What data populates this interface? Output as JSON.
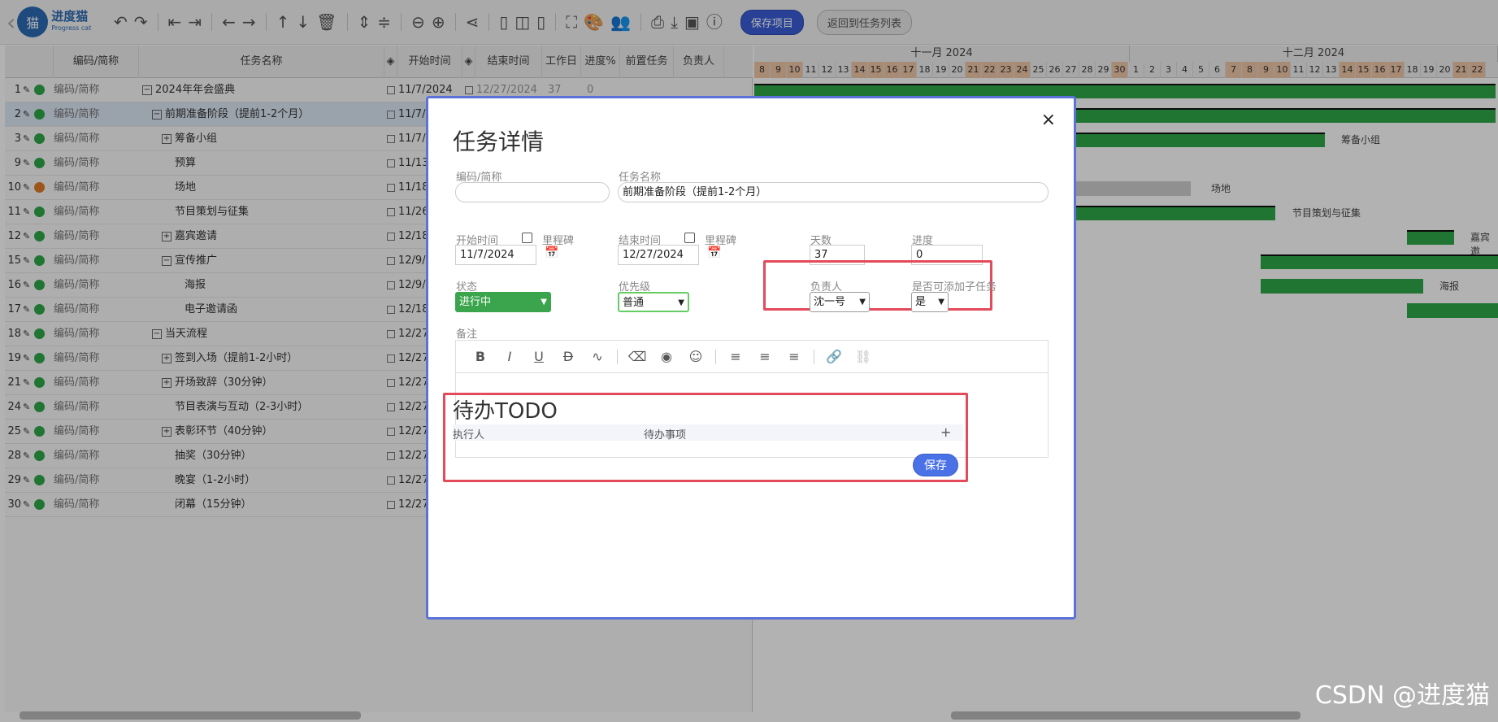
{
  "app": {
    "logo_text": "进度猫",
    "logo_sub": "Progress cat",
    "logo_char": "猫"
  },
  "toolbar": {
    "save_project": "保存项目",
    "back_to_list": "返回到任务列表"
  },
  "grid": {
    "headers": {
      "code": "编码/简称",
      "name": "任务名称",
      "start": "开始时间",
      "end": "结束时间",
      "workdays": "工作日",
      "progress": "进度%",
      "predecessor": "前置任务",
      "owner": "负责人"
    },
    "rows": [
      {
        "id": "1",
        "code": "编码/简称",
        "name": "2024年年会盛典",
        "start": "11/7/2024",
        "end": "12/27/2024",
        "days": "37",
        "prog": "0",
        "status": "green",
        "exp": "−",
        "indent": 0
      },
      {
        "id": "2",
        "code": "编码/简称",
        "name": "前期准备阶段（提前1-2个月）",
        "start": "11/7/2",
        "end": "",
        "days": "",
        "prog": "",
        "status": "green",
        "exp": "−",
        "indent": 1
      },
      {
        "id": "3",
        "code": "编码/简称",
        "name": "筹备小组",
        "start": "11/7/2",
        "end": "",
        "days": "",
        "prog": "",
        "status": "green",
        "exp": "+",
        "indent": 2
      },
      {
        "id": "9",
        "code": "编码/简称",
        "name": "预算",
        "start": "11/13/",
        "end": "",
        "days": "",
        "prog": "",
        "status": "green",
        "exp": "",
        "indent": 2
      },
      {
        "id": "10",
        "code": "编码/简称",
        "name": "场地",
        "start": "11/18/",
        "end": "",
        "days": "",
        "prog": "",
        "status": "orange",
        "exp": "",
        "indent": 2
      },
      {
        "id": "11",
        "code": "编码/简称",
        "name": "节目策划与征集",
        "start": "11/26/",
        "end": "",
        "days": "",
        "prog": "",
        "status": "green",
        "exp": "",
        "indent": 2
      },
      {
        "id": "12",
        "code": "编码/简称",
        "name": "嘉宾邀请",
        "start": "12/18/",
        "end": "",
        "days": "",
        "prog": "",
        "status": "green",
        "exp": "+",
        "indent": 2
      },
      {
        "id": "15",
        "code": "编码/简称",
        "name": "宣传推广",
        "start": "12/9/2",
        "end": "",
        "days": "",
        "prog": "",
        "status": "green",
        "exp": "−",
        "indent": 2
      },
      {
        "id": "16",
        "code": "编码/简称",
        "name": "海报",
        "start": "12/9/2",
        "end": "",
        "days": "",
        "prog": "",
        "status": "green",
        "exp": "",
        "indent": 3
      },
      {
        "id": "17",
        "code": "编码/简称",
        "name": "电子邀请函",
        "start": "12/18/",
        "end": "",
        "days": "",
        "prog": "",
        "status": "green",
        "exp": "",
        "indent": 3
      },
      {
        "id": "18",
        "code": "编码/简称",
        "name": "当天流程",
        "start": "12/27/",
        "end": "",
        "days": "",
        "prog": "",
        "status": "green",
        "exp": "−",
        "indent": 1
      },
      {
        "id": "19",
        "code": "编码/简称",
        "name": "签到入场（提前1-2小时）",
        "start": "12/27/",
        "end": "",
        "days": "",
        "prog": "",
        "status": "green",
        "exp": "+",
        "indent": 2
      },
      {
        "id": "21",
        "code": "编码/简称",
        "name": "开场致辞（30分钟）",
        "start": "12/27/",
        "end": "",
        "days": "",
        "prog": "",
        "status": "green",
        "exp": "+",
        "indent": 2
      },
      {
        "id": "24",
        "code": "编码/简称",
        "name": "节目表演与互动（2-3小时）",
        "start": "12/27/",
        "end": "",
        "days": "",
        "prog": "",
        "status": "green",
        "exp": "",
        "indent": 2
      },
      {
        "id": "25",
        "code": "编码/简称",
        "name": "表彰环节（40分钟）",
        "start": "12/27/",
        "end": "",
        "days": "",
        "prog": "",
        "status": "green",
        "exp": "+",
        "indent": 2
      },
      {
        "id": "28",
        "code": "编码/简称",
        "name": "抽奖（30分钟）",
        "start": "12/27/",
        "end": "",
        "days": "",
        "prog": "",
        "status": "green",
        "exp": "",
        "indent": 2
      },
      {
        "id": "29",
        "code": "编码/简称",
        "name": "晚宴（1-2小时）",
        "start": "12/27/",
        "end": "",
        "days": "",
        "prog": "",
        "status": "green",
        "exp": "",
        "indent": 2
      },
      {
        "id": "30",
        "code": "编码/简称",
        "name": "闭幕（15分钟）",
        "start": "12/27/",
        "end": "",
        "days": "",
        "prog": "",
        "status": "green",
        "exp": "",
        "indent": 2
      }
    ]
  },
  "gantt": {
    "months": [
      "十一月 2024",
      "十二月 2024"
    ],
    "days": [
      "8",
      "9",
      "10",
      "11",
      "12",
      "13",
      "14",
      "15",
      "16",
      "17",
      "18",
      "19",
      "20",
      "21",
      "22",
      "23",
      "24",
      "25",
      "26",
      "27",
      "28",
      "29",
      "30",
      "1",
      "2",
      "3",
      "4",
      "5",
      "6",
      "7",
      "8",
      "9",
      "10",
      "11",
      "12",
      "13",
      "14",
      "15",
      "16",
      "17",
      "18",
      "19",
      "20",
      "21",
      "22"
    ],
    "weekend": [
      "9",
      "10",
      "16",
      "17",
      "23",
      "24",
      "30",
      "7",
      "8",
      "14",
      "15",
      "21",
      "22"
    ],
    "labels": {
      "choubei": "筹备小组",
      "changdi": "场地",
      "jiemu": "节目策划与征集",
      "jiabin": "嘉宾邀",
      "haibao": "海报"
    }
  },
  "modal": {
    "title": "任务详情",
    "code_label": "编码/简称",
    "code_value": "",
    "name_label": "任务名称",
    "name_value": "前期准备阶段（提前1-2个月）",
    "start_label": "开始时间",
    "milestone_label": "里程碑",
    "start_value": "11/7/2024",
    "end_label": "结束时间",
    "end_value": "12/27/2024",
    "days_label": "天数",
    "days_value": "37",
    "progress_label": "进度",
    "progress_value": "0",
    "status_label": "状态",
    "status_value": "进行中",
    "priority_label": "优先级",
    "priority_value": "普通",
    "owner_label": "负责人",
    "owner_value": "沈一号",
    "subtask_label": "是否可添加子任务",
    "subtask_value": "是",
    "note_label": "备注",
    "todo_title": "待办TODO",
    "todo_col_assignee": "执行人",
    "todo_col_item": "待办事项",
    "todo_add": "+",
    "save": "保存",
    "close": "×"
  },
  "watermark": "CSDN @进度猫"
}
